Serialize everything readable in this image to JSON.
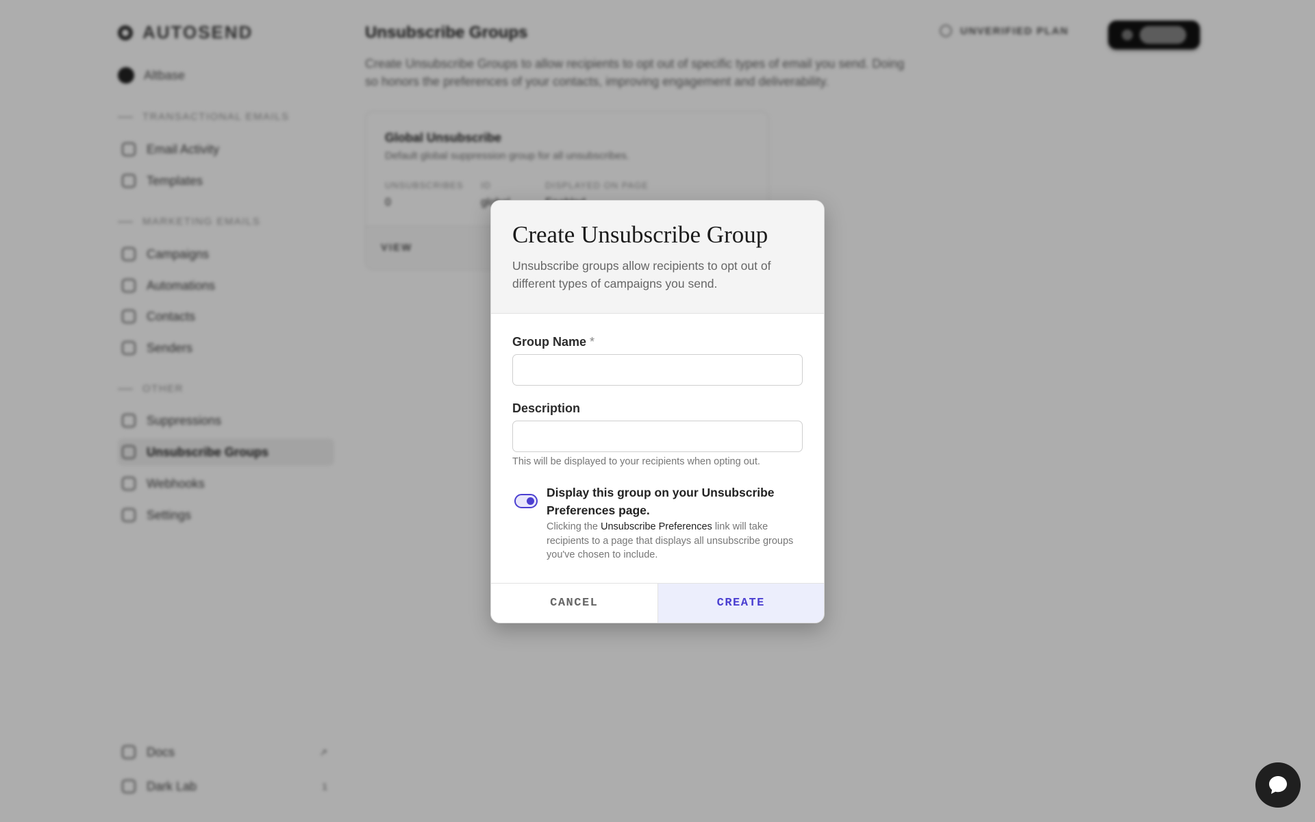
{
  "app": {
    "logo_text": "AUTOSEND",
    "account_name": "Altbase",
    "sections": [
      {
        "label": "TRANSACTIONAL EMAILS",
        "items": [
          {
            "label": "Email Activity"
          },
          {
            "label": "Templates"
          }
        ]
      },
      {
        "label": "MARKETING EMAILS",
        "items": [
          {
            "label": "Campaigns"
          },
          {
            "label": "Automations"
          },
          {
            "label": "Contacts"
          },
          {
            "label": "Senders"
          }
        ]
      },
      {
        "label": "OTHER",
        "items": [
          {
            "label": "Suppressions"
          },
          {
            "label": "Unsubscribe Groups"
          },
          {
            "label": "Webhooks"
          },
          {
            "label": "Settings"
          }
        ]
      }
    ],
    "bottom_items": [
      {
        "label": "Docs",
        "badge": "↗"
      },
      {
        "label": "Dark Lab",
        "badge": "1"
      }
    ],
    "top_right": {
      "status_text": "UNVERIFIED PLAN"
    }
  },
  "page": {
    "title": "Unsubscribe Groups",
    "subtitle": "Create Unsubscribe Groups to allow recipients to opt out of specific types of email you send. Doing so honors the preferences of your contacts, improving engagement and deliverability.",
    "card": {
      "title": "Global Unsubscribe",
      "description": "Default global suppression group for all unsubscribes.",
      "stats": [
        {
          "label": "UNSUBSCRIBES",
          "value": "0"
        },
        {
          "label": "ID",
          "value": "global"
        },
        {
          "label": "DISPLAYED ON PAGE",
          "value": "Enabled"
        }
      ],
      "footer_button": "VIEW"
    }
  },
  "modal": {
    "title": "Create Unsubscribe Group",
    "subtitle": "Unsubscribe groups allow recipients to opt out of different types of campaigns you send.",
    "group_name_label": "Group Name",
    "required_mark": "*",
    "group_name_value": "",
    "description_label": "Description",
    "description_value": "",
    "description_hint": "This will be displayed to your recipients when opting out.",
    "toggle_on": true,
    "toggle_title": "Display this group on your Unsubscribe Preferences page.",
    "toggle_desc_before": "Clicking the",
    "toggle_desc_link": "Unsubscribe Preferences",
    "toggle_desc_after": "link will take recipients to a page that displays all unsubscribe groups you've chosen to include.",
    "cancel_label": "CANCEL",
    "create_label": "CREATE",
    "accent_color": "#4b3fd1"
  },
  "chat": {
    "icon": "chat-bubble-icon"
  }
}
